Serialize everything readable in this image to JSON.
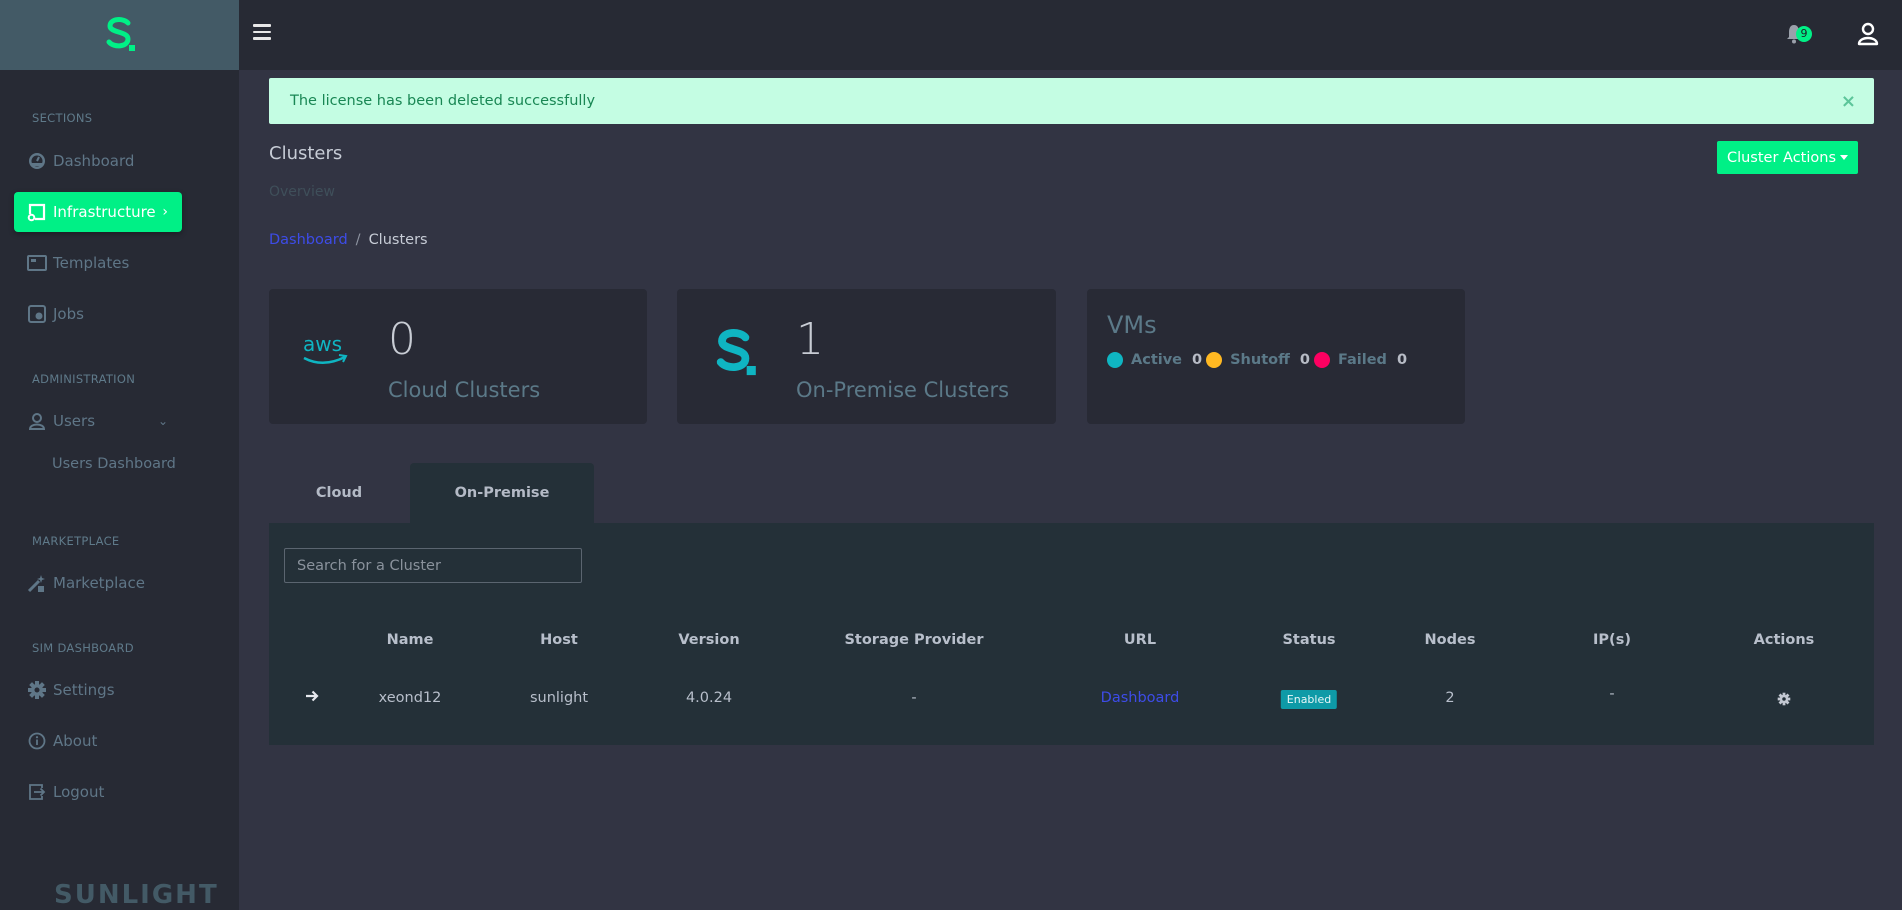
{
  "sidebar": {
    "sections": [
      {
        "title": "SECTIONS"
      },
      {
        "title": "ADMINISTRATION"
      },
      {
        "title": "MARKETPLACE"
      },
      {
        "title": "SIM DASHBOARD"
      }
    ],
    "items": [
      {
        "label": "Dashboard",
        "icon": "gauge-icon"
      },
      {
        "label": "Infrastructure",
        "icon": "cast-icon",
        "active": true
      },
      {
        "label": "Templates",
        "icon": "template-icon"
      },
      {
        "label": "Jobs",
        "icon": "jobs-icon"
      },
      {
        "label": "Users",
        "icon": "user-icon"
      },
      {
        "label": "Marketplace",
        "icon": "magic-wand-icon"
      },
      {
        "label": "Settings",
        "icon": "gear-icon"
      },
      {
        "label": "About",
        "icon": "info-icon"
      },
      {
        "label": "Logout",
        "icon": "logout-icon"
      }
    ],
    "sub_items": [
      {
        "label": "Users Dashboard"
      }
    ],
    "footer": "SUNLIGHT",
    "accent": "#00f086"
  },
  "topbar": {
    "notifications_count": "9"
  },
  "alert": {
    "message": "The license has been deleted successfully",
    "close": "×"
  },
  "page": {
    "title": "Clusters",
    "subtitle": "Overview",
    "actions_button": "Cluster Actions"
  },
  "breadcrumb": {
    "root": "Dashboard",
    "separator": "/",
    "current": "Clusters"
  },
  "cards": {
    "cloud": {
      "count": "0",
      "label": "Cloud Clusters",
      "icon": "aws-logo-icon"
    },
    "onprem": {
      "count": "1",
      "label": "On-Premise Clusters",
      "icon": "sunlight-logo-icon"
    },
    "vms": {
      "title": "VMs",
      "statuses": [
        {
          "label": "Active",
          "count": "0",
          "color": "#0fb5c2"
        },
        {
          "label": "Shutoff",
          "count": "0",
          "color": "#ffb822"
        },
        {
          "label": "Failed",
          "count": "0",
          "color": "#fd0061"
        }
      ]
    }
  },
  "tabs": [
    {
      "label": "Cloud",
      "active": false
    },
    {
      "label": "On-Premise",
      "active": true
    }
  ],
  "search": {
    "placeholder": "Search for a Cluster",
    "value": ""
  },
  "table": {
    "columns": [
      "Name",
      "Host",
      "Version",
      "Storage Provider",
      "URL",
      "Status",
      "Nodes",
      "IP(s)",
      "Actions"
    ],
    "rows": [
      {
        "name": "xeond12",
        "host": "sunlight",
        "version": "4.0.24",
        "storage_provider": "-",
        "url": "Dashboard",
        "status": "Enabled",
        "nodes": "2",
        "ips": "-"
      }
    ]
  }
}
